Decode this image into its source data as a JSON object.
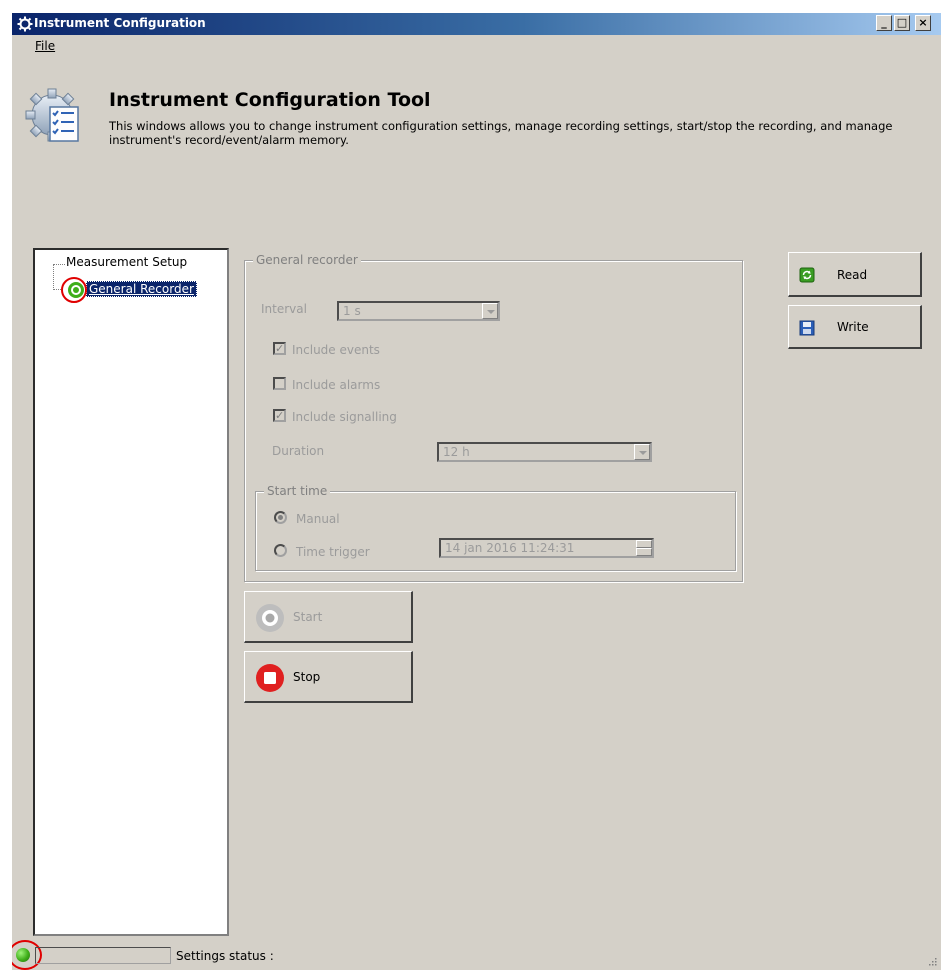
{
  "window": {
    "title": "Instrument Configuration",
    "controls": {
      "minimize": "_",
      "maximize": "□",
      "close": "×"
    }
  },
  "menu": {
    "file": "File"
  },
  "header": {
    "title": "Instrument Configuration Tool",
    "description": "This windows allows you to change instrument configuration settings, manage recording settings, start/stop the recording, and manage instrument's record/event/alarm memory."
  },
  "tree": {
    "root": "Measurement Setup",
    "child": "General Recorder"
  },
  "general_recorder": {
    "group_label": "General recorder",
    "interval_label": "Interval",
    "interval_value": "1 s",
    "include_events": {
      "label": "Include events",
      "checked": true
    },
    "include_alarms": {
      "label": "Include alarms",
      "checked": false
    },
    "include_signalling": {
      "label": "Include signalling",
      "checked": true
    },
    "duration_label": "Duration",
    "duration_value": "12 h",
    "start_time": {
      "group_label": "Start time",
      "manual_label": "Manual",
      "time_trigger_label": "Time trigger",
      "trigger_value": "14 jan  2016 11:24:31"
    }
  },
  "buttons": {
    "read": "Read",
    "write": "Write",
    "start": "Start",
    "stop": "Stop"
  },
  "status": {
    "label": "Settings status :",
    "indicator_color": "#3fae1a"
  },
  "colors": {
    "window_bg": "#d4d0c8",
    "title_gradient_start": "#0a246a",
    "selection": "#0a246a",
    "annotation_red": "#e00000"
  }
}
